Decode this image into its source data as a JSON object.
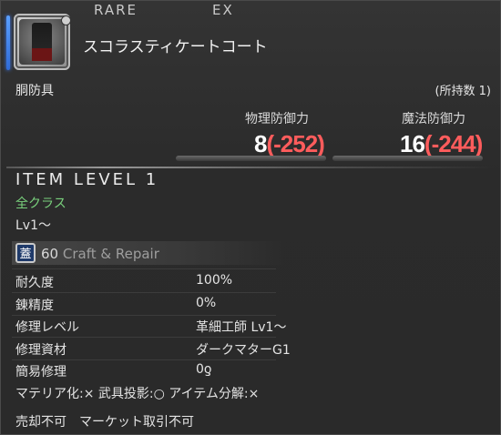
{
  "header": {
    "rarity": "RARE",
    "ex": "EX"
  },
  "item": {
    "name": "スコラスティケートコート",
    "category": "胴防具",
    "owned": "(所持数 1)"
  },
  "stats": [
    {
      "label": "物理防御力",
      "value": "8",
      "delta": "(-252)"
    },
    {
      "label": "魔法防御力",
      "value": "16",
      "delta": "(-244)"
    }
  ],
  "item_level": "ITEM LEVEL 1",
  "classes": "全クラス",
  "level": "Lv1～",
  "craft": {
    "icon_glyph": "蓋",
    "level": "60",
    "text": "Craft & Repair"
  },
  "details": [
    {
      "label": "耐久度",
      "value": "100%"
    },
    {
      "label": "錬精度",
      "value": "0%"
    },
    {
      "label": "修理レベル",
      "value": "革細工師 Lv1～"
    },
    {
      "label": "修理資材",
      "value": "ダークマターG1"
    },
    {
      "label": "簡易修理",
      "value": "0ƍ"
    }
  ],
  "flags_line": "マテリア化:× 武具投影:○ アイテム分解:×",
  "trade_line": "売却不可　マーケット取引不可",
  "colors": {
    "accent_blue": "#3b7dff",
    "delta_red": "#ff5c5c",
    "class_green": "#79d07c"
  }
}
